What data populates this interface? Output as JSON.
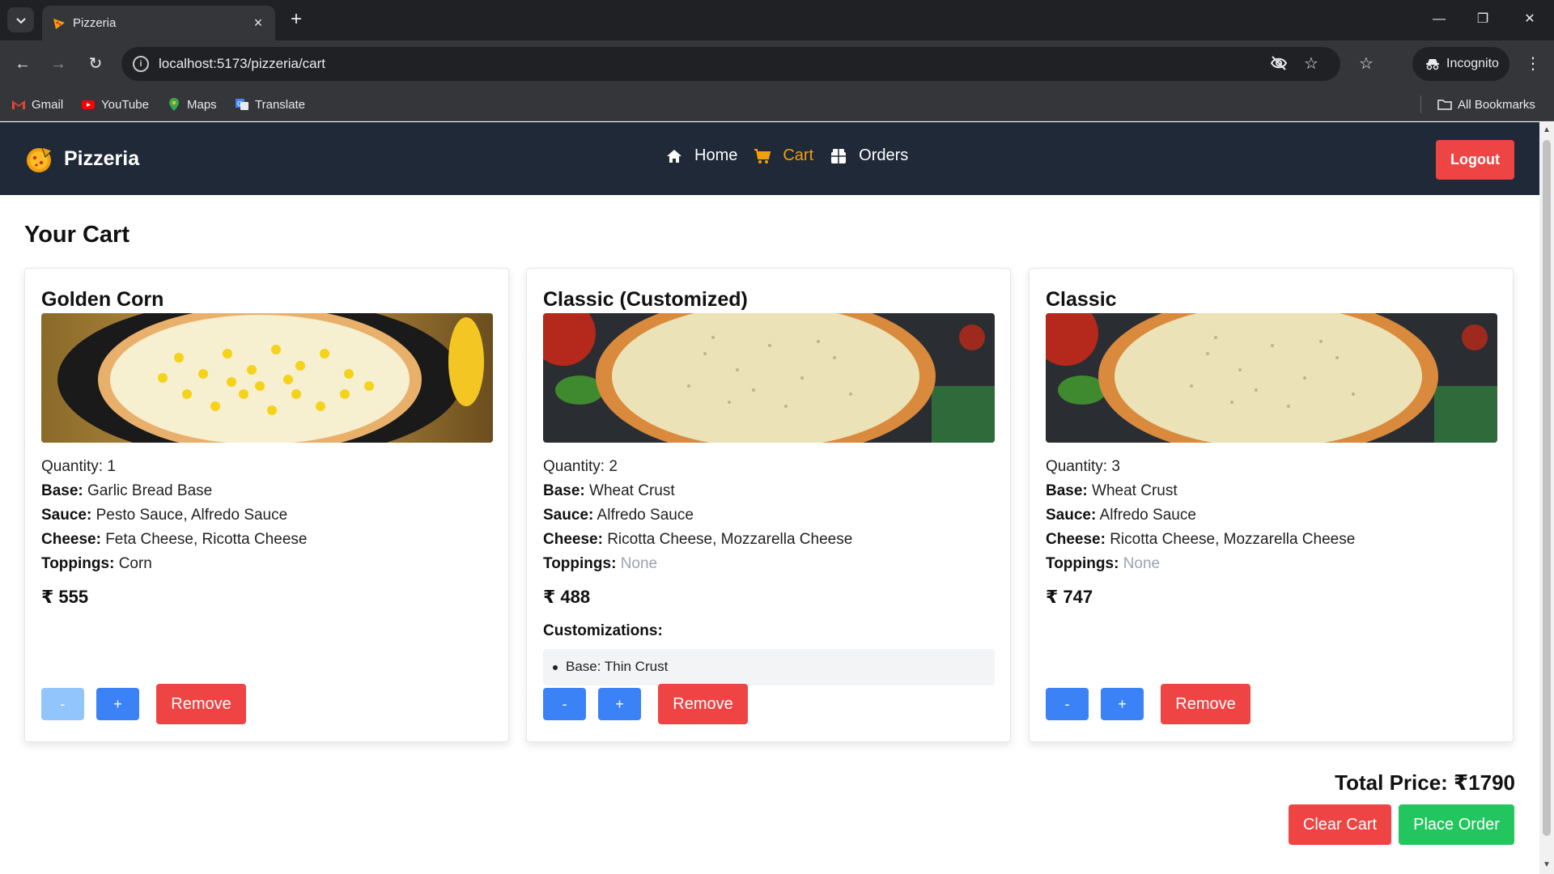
{
  "browser": {
    "tab_title": "Pizzeria",
    "url": "localhost:5173/pizzeria/cart",
    "incognito_label": "Incognito",
    "bookmarks": [
      "Gmail",
      "YouTube",
      "Maps",
      "Translate"
    ],
    "all_bookmarks": "All Bookmarks"
  },
  "navbar": {
    "brand": "Pizzeria",
    "links": [
      {
        "label": "Home",
        "active": false
      },
      {
        "label": "Cart",
        "active": true
      },
      {
        "label": "Orders",
        "active": false
      }
    ],
    "logout": "Logout"
  },
  "cart": {
    "title": "Your Cart",
    "items": [
      {
        "name": "Golden Corn",
        "quantity": "Quantity: 1",
        "base_label": "Base:",
        "base": "Garlic Bread Base",
        "sauce_label": "Sauce:",
        "sauce": "Pesto Sauce, Alfredo Sauce",
        "cheese_label": "Cheese:",
        "cheese": "Feta Cheese, Ricotta Cheese",
        "toppings_label": "Toppings:",
        "toppings": "Corn",
        "price": "₹ 555",
        "minus": "-",
        "plus": "+",
        "remove": "Remove"
      },
      {
        "name": "Classic (Customized)",
        "quantity": "Quantity: 2",
        "base_label": "Base:",
        "base": "Wheat Crust",
        "sauce_label": "Sauce:",
        "sauce": "Alfredo Sauce",
        "cheese_label": "Cheese:",
        "cheese": "Ricotta Cheese, Mozzarella Cheese",
        "toppings_label": "Toppings:",
        "toppings": "None",
        "price": "₹ 488",
        "customizations_title": "Customizations:",
        "customizations": [
          "Base: Thin Crust"
        ],
        "minus": "-",
        "plus": "+",
        "remove": "Remove"
      },
      {
        "name": "Classic",
        "quantity": "Quantity: 3",
        "base_label": "Base:",
        "base": "Wheat Crust",
        "sauce_label": "Sauce:",
        "sauce": "Alfredo Sauce",
        "cheese_label": "Cheese:",
        "cheese": "Ricotta Cheese, Mozzarella Cheese",
        "toppings_label": "Toppings:",
        "toppings": "None",
        "price": "₹ 747",
        "minus": "-",
        "plus": "+",
        "remove": "Remove"
      }
    ],
    "total": "Total Price: ₹1790",
    "clear": "Clear Cart",
    "place": "Place Order"
  },
  "colors": {
    "navbar_bg": "#1f2937",
    "active_link": "#f59e0b",
    "danger": "#ef4444",
    "primary": "#3b82f6",
    "success": "#22c55e"
  }
}
